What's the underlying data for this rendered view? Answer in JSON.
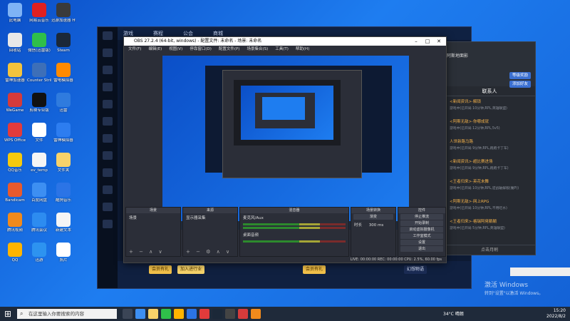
{
  "desktop_icons": [
    {
      "label": "此电脑",
      "color": "#7fb3f5"
    },
    {
      "label": "网易云音乐",
      "color": "#e02020"
    },
    {
      "label": "迅游加速器 HUD",
      "color": "#3a3a3a"
    },
    {
      "label": "回收站",
      "color": "#e8e8e8"
    },
    {
      "label": "微信(迅雷版)",
      "color": "#2fbf4a"
    },
    {
      "label": "Steam",
      "color": "#1b2838"
    },
    {
      "label": "雷神加速器",
      "color": "#f3c33d"
    },
    {
      "label": "Counter Strike",
      "color": "#3d6fb8"
    },
    {
      "label": "雷电模拟器",
      "color": "#ff8a00"
    },
    {
      "label": "WeGame",
      "color": "#d53b3b"
    },
    {
      "label": "剪映专业版",
      "color": "#111111"
    },
    {
      "label": "迅雷",
      "color": "#2f7bde"
    },
    {
      "label": "WPS Office",
      "color": "#e23b3b"
    },
    {
      "label": "文件",
      "color": "#ffffff"
    },
    {
      "label": "雷神模拟器",
      "color": "#2d7df0"
    },
    {
      "label": "QQ音乐",
      "color": "#f6c90e"
    },
    {
      "label": "ev_temp",
      "color": "#f5f5f5"
    },
    {
      "label": "文件夹",
      "color": "#f7d26a"
    },
    {
      "label": "Bandicam",
      "color": "#e85a2d"
    },
    {
      "label": "百度网盘",
      "color": "#3d8ff2"
    },
    {
      "label": "酷狗音乐",
      "color": "#2b74e6"
    },
    {
      "label": "腾讯视频",
      "color": "#f08a1c"
    },
    {
      "label": "腾讯会议",
      "color": "#2d8cf0"
    },
    {
      "label": "新建文本",
      "color": "#f5f5f5"
    },
    {
      "label": "QQ",
      "color": "#ffb400"
    },
    {
      "label": "迅游",
      "color": "#2d93f0"
    },
    {
      "label": "照片",
      "color": "#ffffff"
    }
  ],
  "game": {
    "tabs": [
      "游戏",
      "赛程",
      "公会",
      "商城"
    ],
    "vip_label": "会员有礼",
    "upgrade_label": "加入进行业",
    "vip_label2": "会员有礼",
    "ad_label": "幻想物语"
  },
  "contacts": {
    "title": "阿斯地面影",
    "btn1": "等级奖励",
    "btn2": "添加好友",
    "tab": "联系人",
    "items": [
      {
        "name": "<新闻资讯>·解锁",
        "status": "游戏中(已开局 10分钟,RPL,英雄联盟)"
      },
      {
        "name": "<阿斯无敌>·你哪成就",
        "status": "游戏中(已开局 12分钟,RPL,5v5)"
      },
      {
        "name": "人世新路马路",
        "status": "游戏中(已开局 9分钟,RPL,跑跑卡丁车)"
      },
      {
        "name": "<新闻资讯>·超比赛进场",
        "status": "游戏中(已开局 9分钟,RPL,跑跑卡丁车)"
      },
      {
        "name": "<王者归来>·英花未舞",
        "status": "游戏中(已开局 10分钟,RPL,逆战破解版(魔P))"
      },
      {
        "name": "<阿斯无敌>·网上RPG",
        "status": "游戏中(已开局 10分钟,RPL,不用吃水)"
      },
      {
        "name": "<王者归来>·格瑞阿佬躺躺",
        "status": "游戏中(已开局 5分钟,RPL,英雄联盟)"
      }
    ],
    "footer": "点击月刷"
  },
  "obs": {
    "title": "OBS 27.2.4 (64-bit, windows) - 配置文件: 未命名 - 场景: 未命名",
    "menus": [
      "文件(F)",
      "编辑(E)",
      "视图(V)",
      "停靠窗口(D)",
      "配置文件(P)",
      "场景集合(S)",
      "工具(T)",
      "帮助(H)"
    ],
    "docks": {
      "scenes_header": "场景",
      "scene_item": "场景",
      "sources_header": "来源",
      "source_item": "显示器采集",
      "mixer_header": "混音器",
      "mixer_item1": "麦克风/Aux",
      "mixer_item2": "桌面音频",
      "transition_header": "场景转换",
      "transition_value": "渐变",
      "duration_label": "时长",
      "duration_value": "300 ms",
      "controls_header": "控件",
      "controls": [
        "停止推流",
        "开始录制",
        "启动虚拟摄像机",
        "工作室模式",
        "设置",
        "退出"
      ]
    },
    "status": "LIVE: 00:00:00  REC: 00:00:00  CPU: 2.5%, 60.00 fps"
  },
  "activation": {
    "line1": "激活 Windows",
    "line2": "转到\"设置\"以激活 Windows。"
  },
  "taskbar": {
    "search_placeholder": "在这里输入你要搜索的内容",
    "weather": "34°C 晴朗",
    "time": "15:20",
    "date": "2022/8/2"
  }
}
